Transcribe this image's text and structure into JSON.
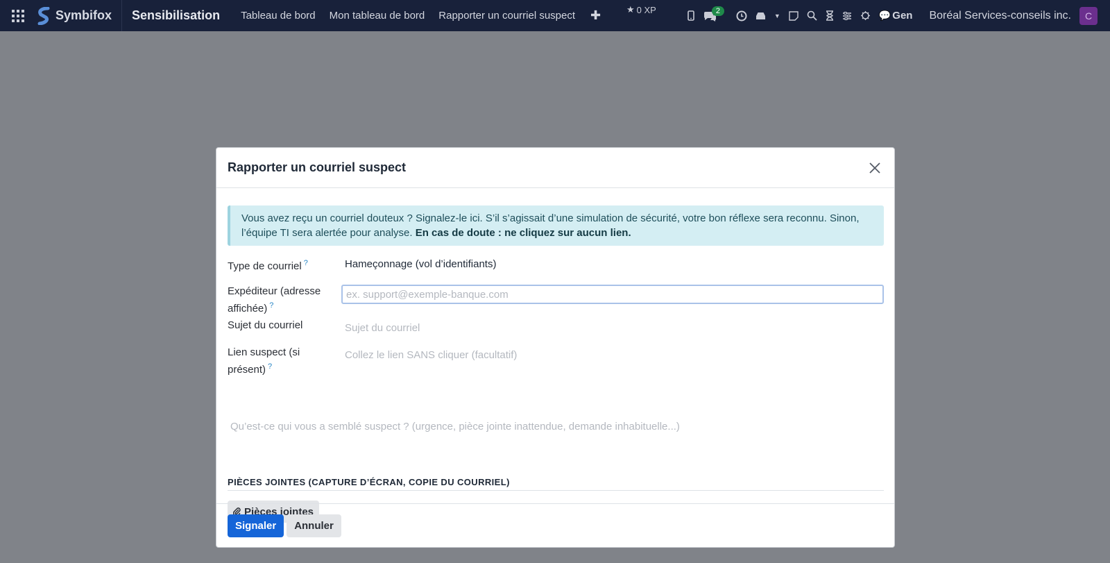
{
  "navbar": {
    "brand": "Symbifox",
    "app_title": "Sensibilisation",
    "menu": [
      "Tableau de bord",
      "Mon tableau de bord",
      "Rapporter un courriel suspect"
    ],
    "xp": "0 XP",
    "message_count": "2",
    "gen_label": "Gen",
    "company": "Boréal Services-conseils inc.",
    "avatar_letter": "C"
  },
  "modal": {
    "title": "Rapporter un courriel suspect",
    "alert_text": "Vous avez reçu un courriel douteux ? Signalez-le ici. S’il s’agissait d’une simulation de sécurité, votre bon réflexe sera reconnu. Sinon, l’équipe TI sera alertée pour analyse. ",
    "alert_bold": "En cas de doute : ne cliquez sur aucun lien.",
    "fields": {
      "type_label": "Type de courriel",
      "type_value": "Hameçonnage (vol d’identifiants)",
      "sender_label": "Expéditeur (adresse affichée)",
      "sender_placeholder": "ex. support@exemple-banque.com",
      "subject_label": "Sujet du courriel",
      "subject_placeholder": "Sujet du courriel",
      "link_label": "Lien suspect (si présent)",
      "link_placeholder": "Collez le lien SANS cliquer (facultatif)",
      "details_placeholder": "Qu’est-ce qui vous a semblé suspect ? (urgence, pièce jointe inattendue, demande inhabituelle...)"
    },
    "tooltip_marker": "?",
    "attachments_section": "PIÈCES JOINTES (CAPTURE D’ÉCRAN, COPIE DU COURRIEL)",
    "attachments_button": "Pièces jointes",
    "submit_label": "Signaler",
    "cancel_label": "Annuler"
  },
  "colors": {
    "navbar_bg": "#18213a",
    "primary": "#1565d8",
    "alert_bg": "#d4eef3",
    "backdrop": "#808389"
  }
}
